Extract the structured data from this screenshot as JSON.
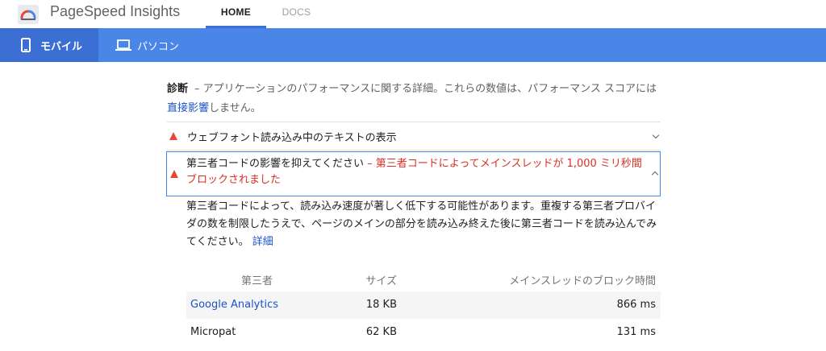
{
  "header": {
    "brand": "PageSpeed Insights",
    "nav": [
      "HOME",
      "DOCS"
    ]
  },
  "device_tabs": {
    "mobile": "モバイル",
    "desktop": "パソコン"
  },
  "diagnostics": {
    "title": "診断",
    "intro": "– アプリケーションのパフォーマンスに関する詳細。これらの数値は、パフォーマンス スコアには",
    "intro_link": "直接影響",
    "intro_tail": "しません。"
  },
  "audits": [
    {
      "title": "ウェブフォント読み込み中のテキストの表示",
      "expanded": false
    },
    {
      "title": "第三者コードの影響を抑えてください",
      "display_value": "– 第三者コードによってメインスレッドが 1,000 ミリ秒間ブロックされました",
      "expanded": true,
      "description": "第三者コードによって、読み込み速度が著しく低下する可能性があります。重複する第三者プロバイダの数を制限したうえで、ページのメインの部分を読み込み終えた後に第三者コードを読み込んでみてください。",
      "learn_more": "詳細"
    }
  ],
  "table": {
    "headers": [
      "第三者",
      "サイズ",
      "メインスレッドのブロック時間"
    ],
    "rows": [
      {
        "entity": "Google Analytics",
        "size": "18 KB",
        "time": "866 ms",
        "link": true
      },
      {
        "entity": "Micropat",
        "size": "62 KB",
        "time": "131 ms",
        "link": false
      }
    ]
  },
  "colors": {
    "tab_bar": "#4a86e8",
    "active_tab": "#3c6fd3",
    "warning": "#e8453c",
    "display_value": "#d93025",
    "link": "#1a53c7"
  }
}
